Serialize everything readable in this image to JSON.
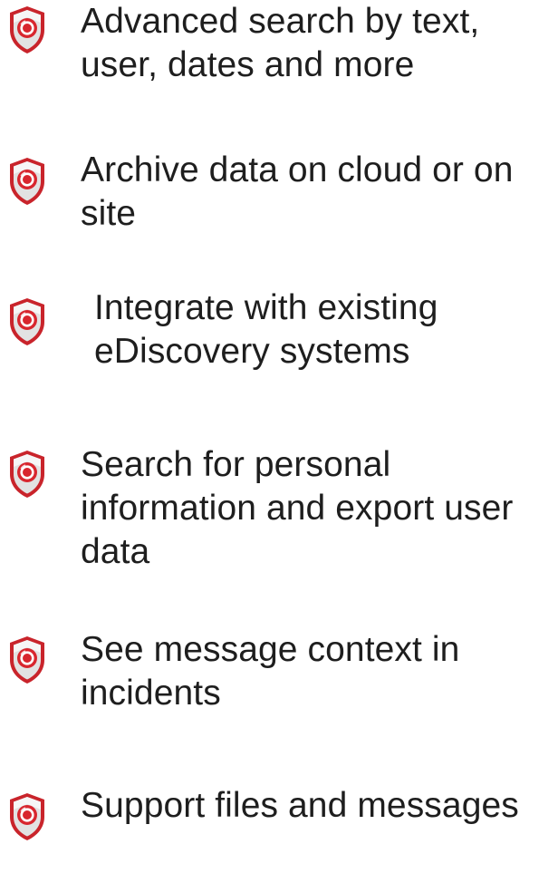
{
  "features": [
    {
      "text": "Advanced search by text, user, dates and more",
      "icon": "shield-icon"
    },
    {
      "text": "Archive data on cloud or on site",
      "icon": "shield-icon"
    },
    {
      "text": "Integrate with existing eDiscovery systems",
      "icon": "shield-icon"
    },
    {
      "text": "Search for personal information and export user data",
      "icon": "shield-icon"
    },
    {
      "text": "See message context in incidents",
      "icon": "shield-icon"
    },
    {
      "text": "Support files and messages",
      "icon": "shield-icon"
    }
  ],
  "colors": {
    "shield_outer": "#c9242b",
    "shield_face": "#e2e2e2",
    "shield_face_highlight": "#ffffff",
    "target_red": "#d8262e",
    "text": "#1e1e1e"
  }
}
